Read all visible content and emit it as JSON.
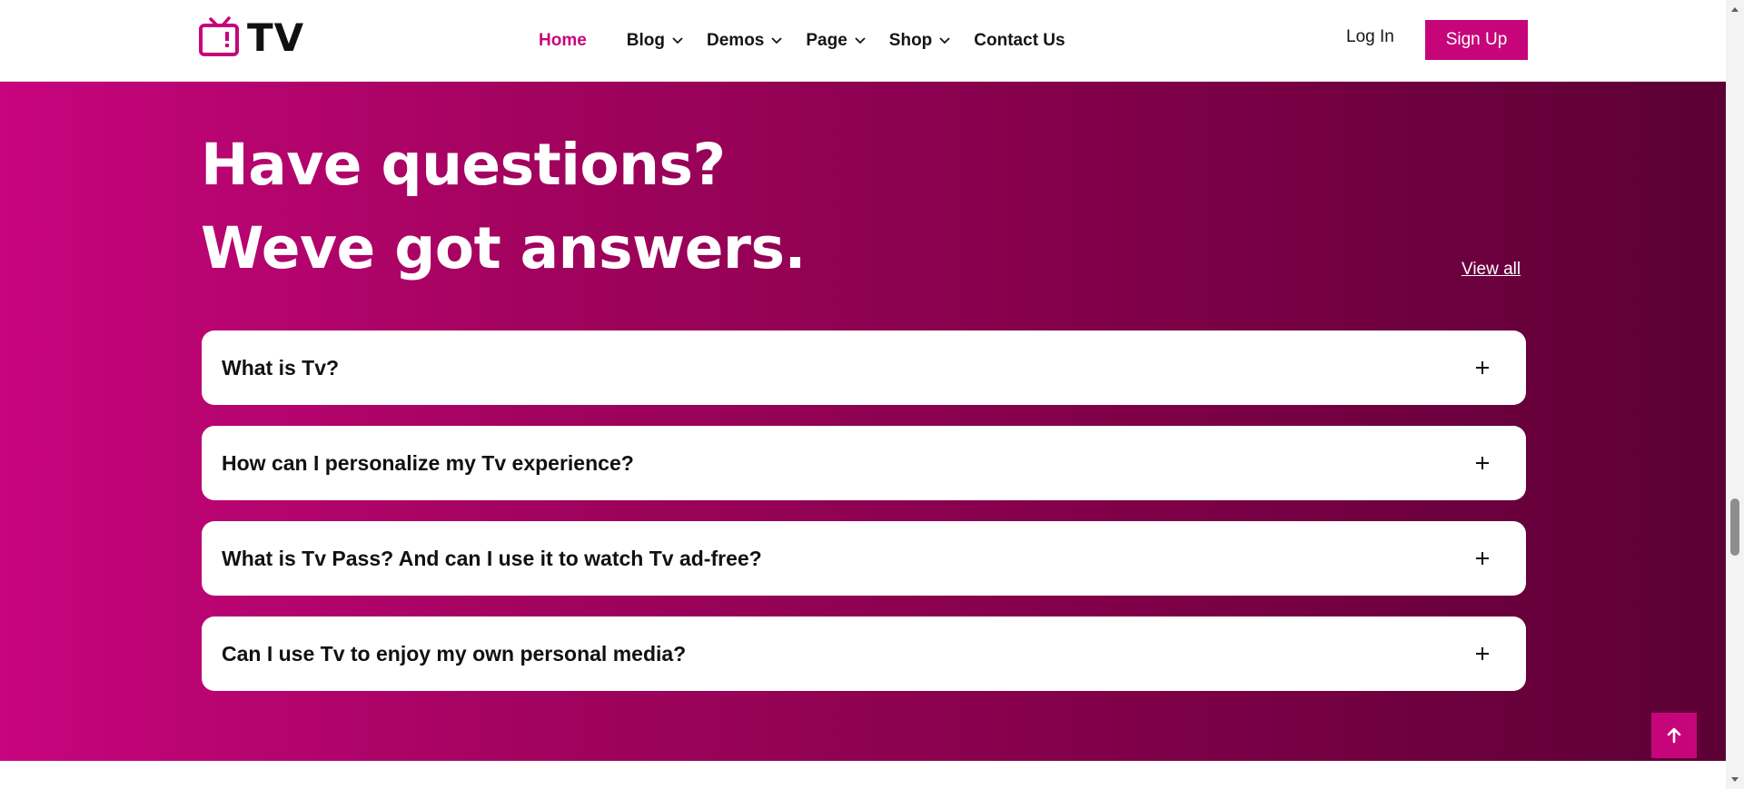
{
  "brand": {
    "name": "TV",
    "accent": "#c7057b"
  },
  "nav": {
    "home": "Home",
    "blog": "Blog",
    "demos": "Demos",
    "page": "Page",
    "shop": "Shop",
    "contact": "Contact Us"
  },
  "auth": {
    "login": "Log In",
    "signup": "Sign Up"
  },
  "faq": {
    "title_line1": "Have questions?",
    "title_line2": "Weve got answers.",
    "view_all": "View all",
    "items": [
      {
        "question": "What is Tv?"
      },
      {
        "question": "How can I personalize my Tv experience?"
      },
      {
        "question": "What is Tv Pass? And can I use it to watch Tv ad-free?"
      },
      {
        "question": "Can I use Tv to enjoy my own personal media?"
      }
    ]
  },
  "icons": {
    "logo": "tv-icon",
    "expand": "plus-icon",
    "dropdown": "chevron-down-icon",
    "back_to_top": "arrow-up-icon"
  }
}
